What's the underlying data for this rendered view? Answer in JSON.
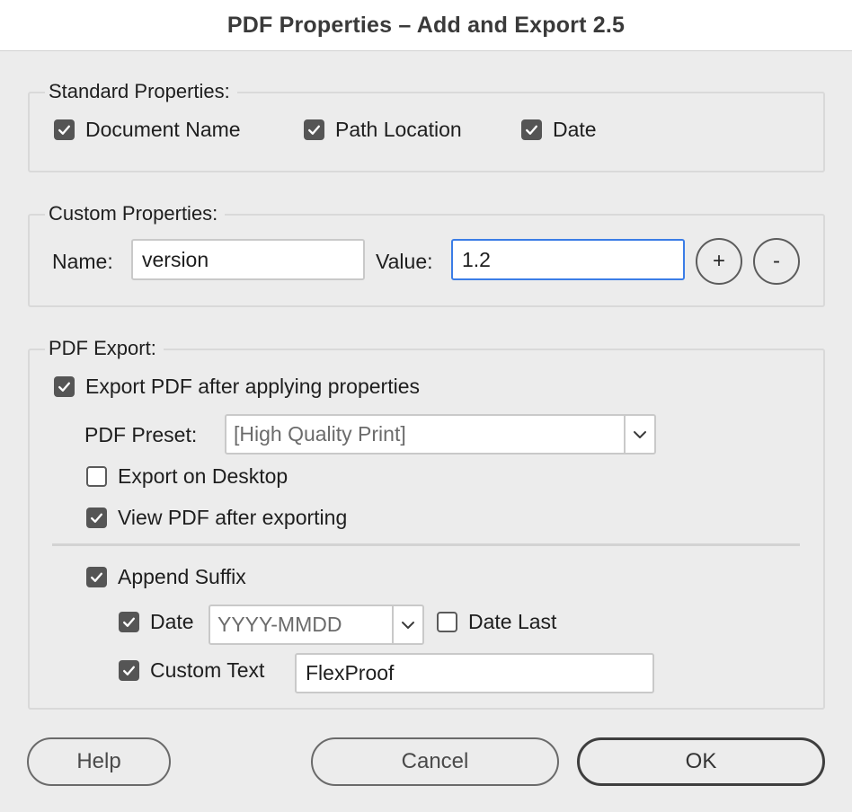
{
  "window": {
    "title": "PDF Properties – Add and Export 2.5"
  },
  "standard": {
    "legend": "Standard Properties:",
    "document_name": {
      "label": "Document Name",
      "checked": true
    },
    "path_location": {
      "label": "Path Location",
      "checked": true
    },
    "date": {
      "label": "Date",
      "checked": true
    }
  },
  "custom": {
    "legend": "Custom Properties:",
    "name_label": "Name:",
    "name_value": "version",
    "value_label": "Value:",
    "value_value": "1.2",
    "add_label": "+",
    "remove_label": "-"
  },
  "export": {
    "legend": "PDF Export:",
    "export_after": {
      "label": "Export PDF after applying properties",
      "checked": true
    },
    "preset_label": "PDF Preset:",
    "preset_value": "[High Quality Print]",
    "export_desktop": {
      "label": "Export on Desktop",
      "checked": false
    },
    "view_after": {
      "label": "View PDF after exporting",
      "checked": true
    },
    "append_suffix": {
      "label": "Append Suffix",
      "checked": true
    },
    "suffix_date": {
      "label": "Date",
      "checked": true
    },
    "date_format": "YYYY-MMDD",
    "date_last": {
      "label": "Date Last",
      "checked": false
    },
    "custom_text": {
      "label": "Custom Text",
      "checked": true
    },
    "custom_text_value": "FlexProof"
  },
  "buttons": {
    "help": "Help",
    "cancel": "Cancel",
    "ok": "OK"
  }
}
